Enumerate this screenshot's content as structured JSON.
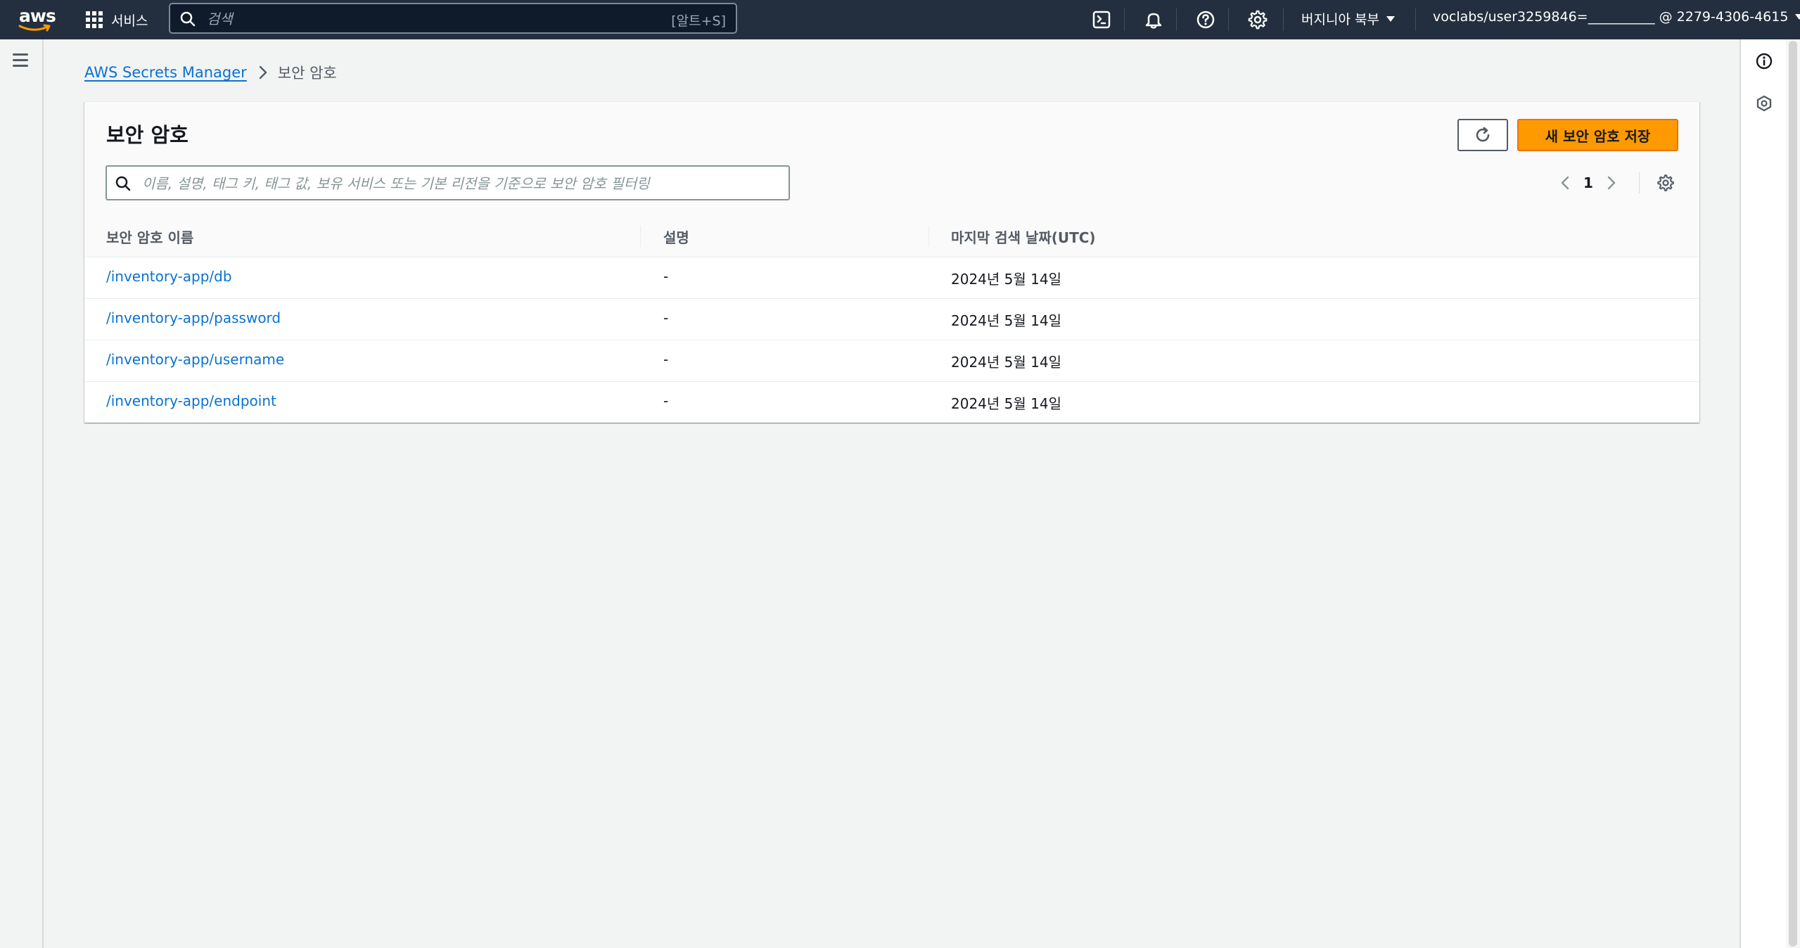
{
  "topnav": {
    "logo_text": "aws",
    "services_label": "서비스",
    "search_placeholder": "검색",
    "search_shortcut": "[알트+S]",
    "region": "버지니아 북부",
    "account": "voclabs/user3259846=__________ @ 2279-4306-4615",
    "icons": [
      "cloudshell-icon",
      "bell-icon",
      "help-icon",
      "settings-icon"
    ]
  },
  "breadcrumb": {
    "root": "AWS Secrets Manager",
    "current": "보안 암호"
  },
  "panel": {
    "title": "보안 암호",
    "create_button": "새 보안 암호 저장",
    "filter_placeholder": "이름, 설명, 태그 키, 태그 값, 보유 서비스 또는 기본 리전을 기준으로 보안 암호 필터링",
    "current_page": "1"
  },
  "table": {
    "columns": [
      "보안 암호 이름",
      "설명",
      "마지막 검색 날짜(UTC)"
    ],
    "rows": [
      {
        "name": "/inventory-app/db",
        "description": "-",
        "last_retrieved": "2024년 5월 14일"
      },
      {
        "name": "/inventory-app/password",
        "description": "-",
        "last_retrieved": "2024년 5월 14일"
      },
      {
        "name": "/inventory-app/username",
        "description": "-",
        "last_retrieved": "2024년 5월 14일"
      },
      {
        "name": "/inventory-app/endpoint",
        "description": "-",
        "last_retrieved": "2024년 5월 14일"
      }
    ]
  },
  "colors": {
    "nav_bg": "#232f3e",
    "primary_button": "#ff9900",
    "link": "#0972d3",
    "page_bg": "#f2f3f3"
  }
}
